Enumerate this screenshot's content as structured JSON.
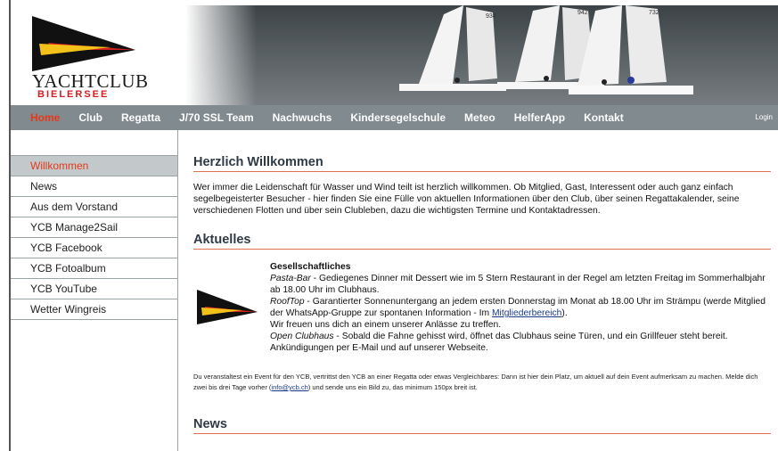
{
  "header": {
    "logo_title": "YACHTCLUB",
    "logo_subtitle": "BIELERSEE",
    "sail_numbers": [
      "934",
      "942",
      "732"
    ]
  },
  "nav": {
    "items": [
      {
        "label": "Home",
        "active": true
      },
      {
        "label": "Club"
      },
      {
        "label": "Regatta"
      },
      {
        "label": "J/70 SSL Team"
      },
      {
        "label": "Nachwuchs"
      },
      {
        "label": "Kindersegelschule"
      },
      {
        "label": "Meteo"
      },
      {
        "label": "HelferApp"
      },
      {
        "label": "Kontakt"
      }
    ],
    "login_label": "Login"
  },
  "sidebar": {
    "items": [
      {
        "label": "Willkommen",
        "active": true
      },
      {
        "label": "News"
      },
      {
        "label": "Aus dem Vorstand"
      },
      {
        "label": "YCB Manage2Sail"
      },
      {
        "label": "YCB Facebook"
      },
      {
        "label": "YCB Fotoalbum"
      },
      {
        "label": "YCB YouTube"
      },
      {
        "label": "Wetter Wingreis"
      }
    ]
  },
  "main": {
    "welcome_heading": "Herzlich Willkommen",
    "welcome_text": "Wer immer die Leidenschaft für Wasser und Wind teilt ist herzlich willkommen. Ob Mitglied, Gast, Interessent oder auch ganz einfach segelbegeisterter Besucher - hier finden Sie eine Fülle von aktuellen Informationen über den Club, über seinen Regattakalender, seine verschiedenen Flotten und über sein Clubleben, dazu die wichtigsten Termine und Kontaktadressen.",
    "news_heading": "Aktuelles",
    "news_item": {
      "title": "Gesellschaftliches",
      "pasta_label": "Pasta-Bar",
      "pasta_text": " - Gediegenes Dinner mit Dessert wie im 5 Stern Restaurant in der Regel am letzten Freitag im Sommerhalbjahr ab 18.00 Uhr im Clubhaus.",
      "rooftop_label": "RoofTop",
      "rooftop_text": " - Garantierter Sonnenuntergang an jedem ersten Donnerstag im Monat ab 18.00 Uhr im Strämpu (werde Mitglied der WhatsApp-Gruppe zur spontanen Information - Im ",
      "rooftop_link": "Mitgliederbereich",
      "rooftop_end": ").",
      "invite_text": "Wir freuen uns dich an einem unserer Anlässe zu treffen.",
      "clubhaus_label": "Open Clubhaus",
      "clubhaus_text": " - Sobald die Fahne gehisst wird, öffnet das Clubhaus seine Türen, und ein Grillfeuer steht bereit. Ankündigungen per E-Mail und auf unserer Webseite."
    },
    "footnote_text": "Du veranstaltest ein Event für den YCB, vertrittst den YCB an einer Regatta oder etwas Vergleichbares: Dann ist hier dein Platz, um aktuell auf dein Event aufmerksam zu machen. Melde dich zwei bis drei Tage vorher (",
    "footnote_email": "info@ycb.ch",
    "footnote_end": ") und sende uns ein Bild zu, das minimum 150px breit ist.",
    "news_heading_2": "News"
  },
  "colors": {
    "nav_bg": "#808a8f",
    "nav_active": "#e83818",
    "sidebar_active_bg": "#c3c8cb",
    "heading_rule": "#e07050",
    "logo_red": "#d02020",
    "logo_yellow": "#f2c21a"
  }
}
